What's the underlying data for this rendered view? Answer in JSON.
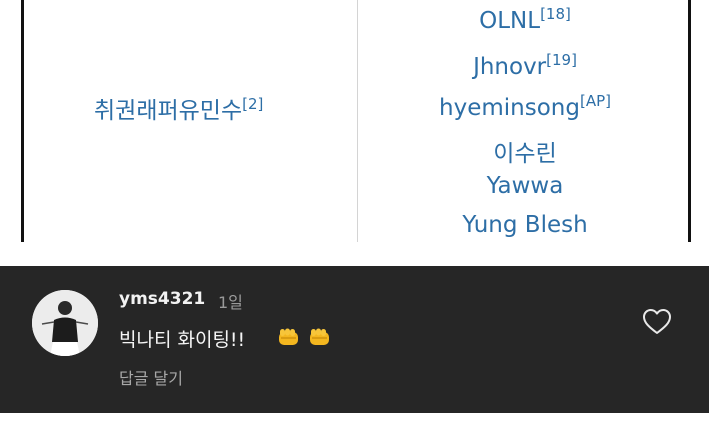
{
  "wiki_table": {
    "left_cell": {
      "name": "취권래퍼유민수",
      "ref": "[2]"
    },
    "right_cell": [
      {
        "name": "OLNL",
        "ref": "[18]"
      },
      {
        "name": "Jhnovr",
        "ref": "[19]"
      },
      {
        "name": "hyeminsong",
        "ref": "[AP]"
      },
      {
        "name": "이수린",
        "ref": ""
      },
      {
        "name": "Yawwa",
        "ref": ""
      },
      {
        "name": "Yung Blesh",
        "ref": ""
      }
    ],
    "link_color": "#2d6ea6"
  },
  "comment": {
    "username": "yms4321",
    "timestamp": "1일",
    "text": "빅나티 화이팅!!",
    "emojis": [
      "oncoming-fist-emoji",
      "oncoming-fist-emoji"
    ],
    "reply_label": "답글 달기",
    "like_icon": "heart-outline-icon",
    "avatar_icon": "avatar-photo",
    "background": "#262626"
  }
}
